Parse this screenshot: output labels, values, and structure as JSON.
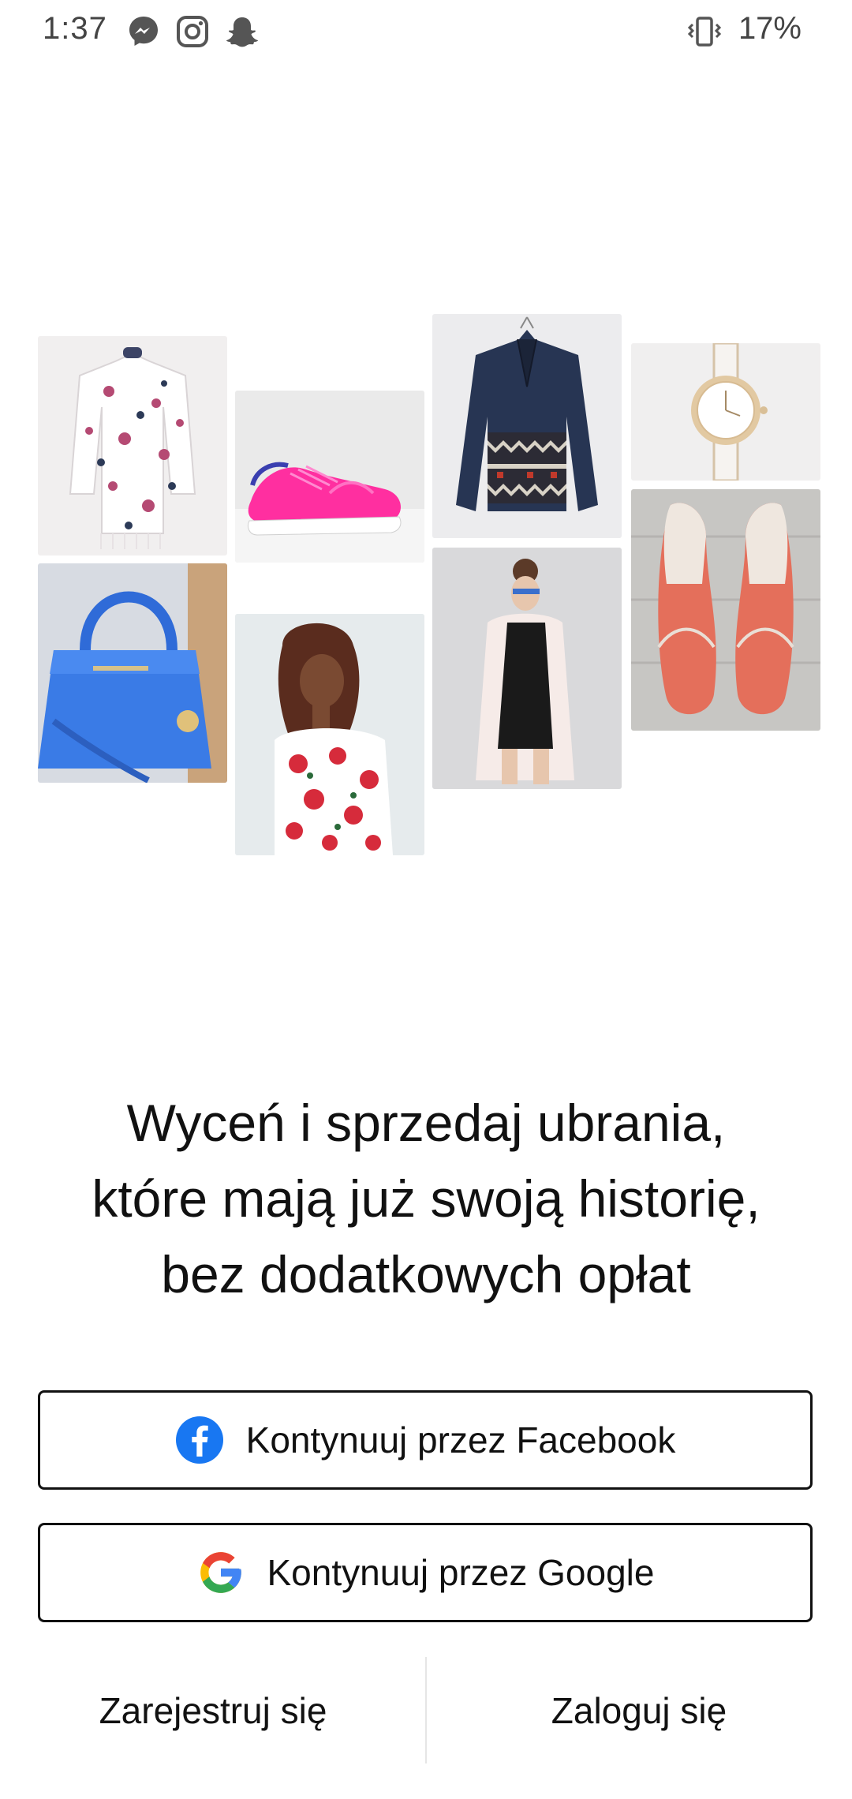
{
  "status_bar": {
    "time": "1:37",
    "battery": "17%",
    "icons": [
      "messenger-icon",
      "instagram-icon",
      "snapchat-icon",
      "vibrate-icon"
    ]
  },
  "gallery": {
    "tiles": [
      "floral-kimono-photo",
      "pink-sneakers-photo",
      "aztec-jacket-photo",
      "gold-watch-photo",
      "blue-handbag-photo",
      "woman-floral-dress-photo",
      "woman-black-outfit-photo",
      "pink-flats-photo"
    ]
  },
  "headline": {
    "line1": "Wyceń i sprzedaj ubrania,",
    "line2": "które mają już swoją historię,",
    "line3": "bez dodatkowych opłat"
  },
  "buttons": {
    "facebook_label": "Kontynuuj przez Facebook",
    "google_label": "Kontynuuj przez Google",
    "register_label": "Zarejestruj się",
    "login_label": "Zaloguj się"
  },
  "colors": {
    "facebook_blue": "#1877F2",
    "google_blue": "#4285F4",
    "google_red": "#EA4335",
    "google_yellow": "#FBBC05",
    "google_green": "#34A853",
    "text": "#111111"
  }
}
